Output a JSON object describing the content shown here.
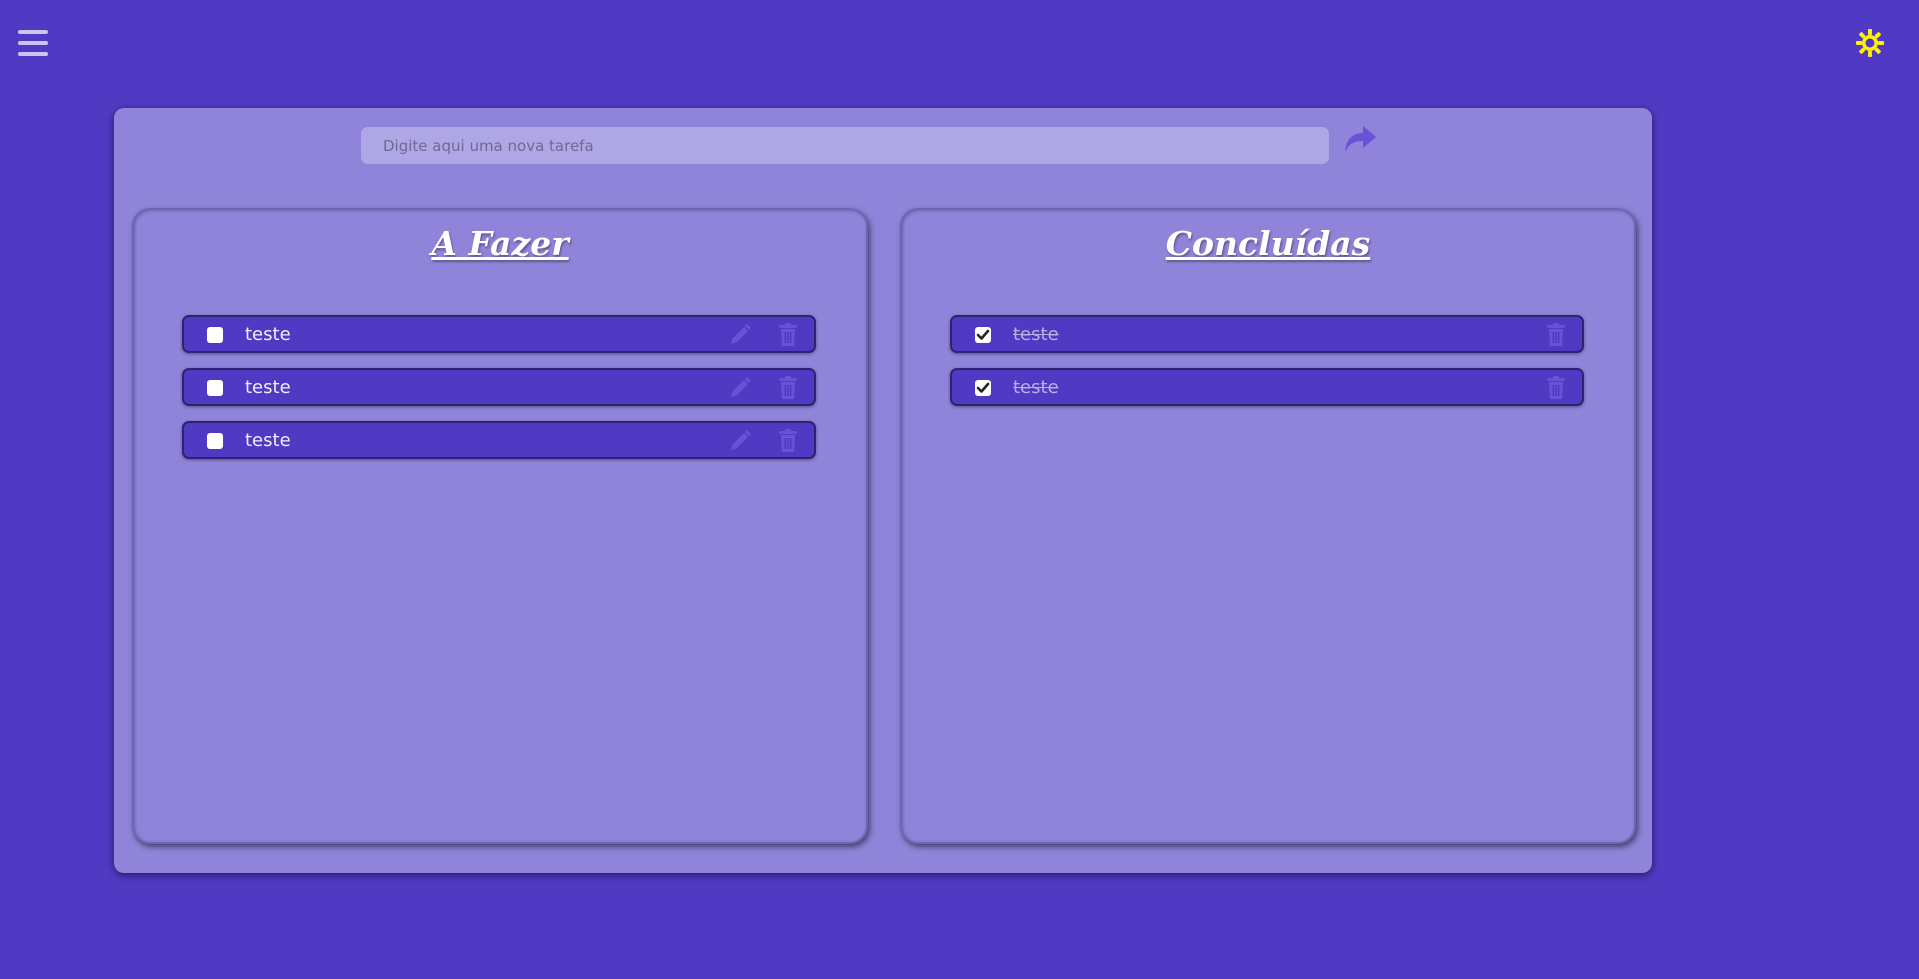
{
  "header": {
    "menu_icon": "hamburger-menu-icon",
    "theme_icon": "sun-icon",
    "theme_icon_color": "#fff200"
  },
  "new_task": {
    "placeholder": "Digite aqui uma nova tarefa",
    "value": "",
    "submit_icon": "share-arrow-icon"
  },
  "todo": {
    "title": "A Fazer",
    "tasks": [
      {
        "text": "teste",
        "checked": false
      },
      {
        "text": "teste",
        "checked": false
      },
      {
        "text": "teste",
        "checked": false
      }
    ]
  },
  "done": {
    "title": "Concluídas",
    "tasks": [
      {
        "text": "teste",
        "checked": true
      },
      {
        "text": "teste",
        "checked": true
      }
    ]
  },
  "colors": {
    "background": "#503ac4",
    "card": "#8f84d9",
    "input": "#afa6e6",
    "task": "#503ac4",
    "accent_icon": "#6a52d6"
  }
}
